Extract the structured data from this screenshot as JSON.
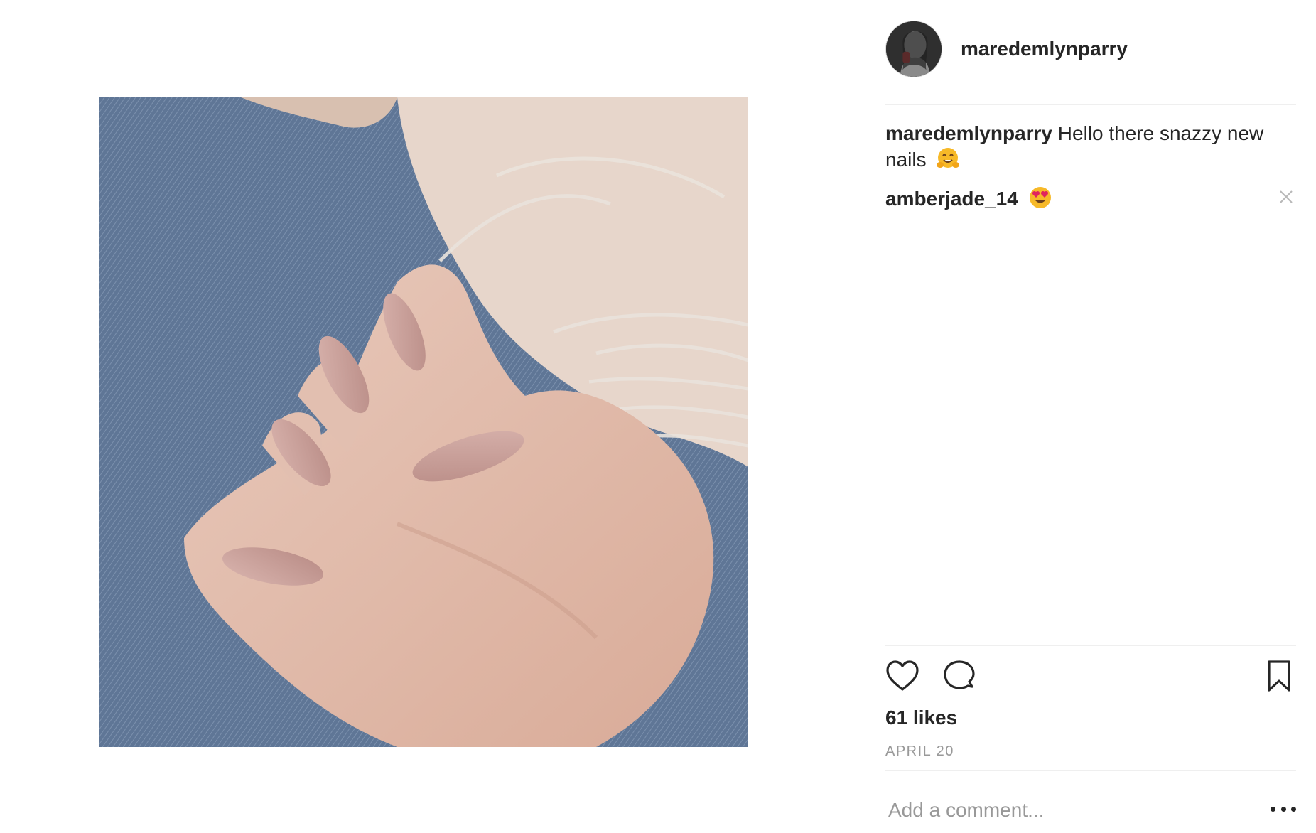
{
  "post": {
    "author": "maredemlynparry",
    "photo_icon": "photo",
    "avatar_icon": "avatar"
  },
  "comments": [
    {
      "user": "maredemlynparry",
      "text": "Hello there snazzy new nails",
      "emoji": "hugging-face"
    },
    {
      "user": "amberjade_14",
      "text": "",
      "emoji": "heart-eyes"
    }
  ],
  "actions": {
    "like_icon": "heart-icon",
    "comment_icon": "comment-icon",
    "save_icon": "bookmark-icon"
  },
  "likes": "61 likes",
  "date": "APRIL 20",
  "add_comment": {
    "placeholder": "Add a comment..."
  },
  "colors": {
    "text": "#262626",
    "muted": "#999999",
    "divider": "#efefef",
    "nail": "#c9a29c",
    "denim": "#5d7494"
  }
}
